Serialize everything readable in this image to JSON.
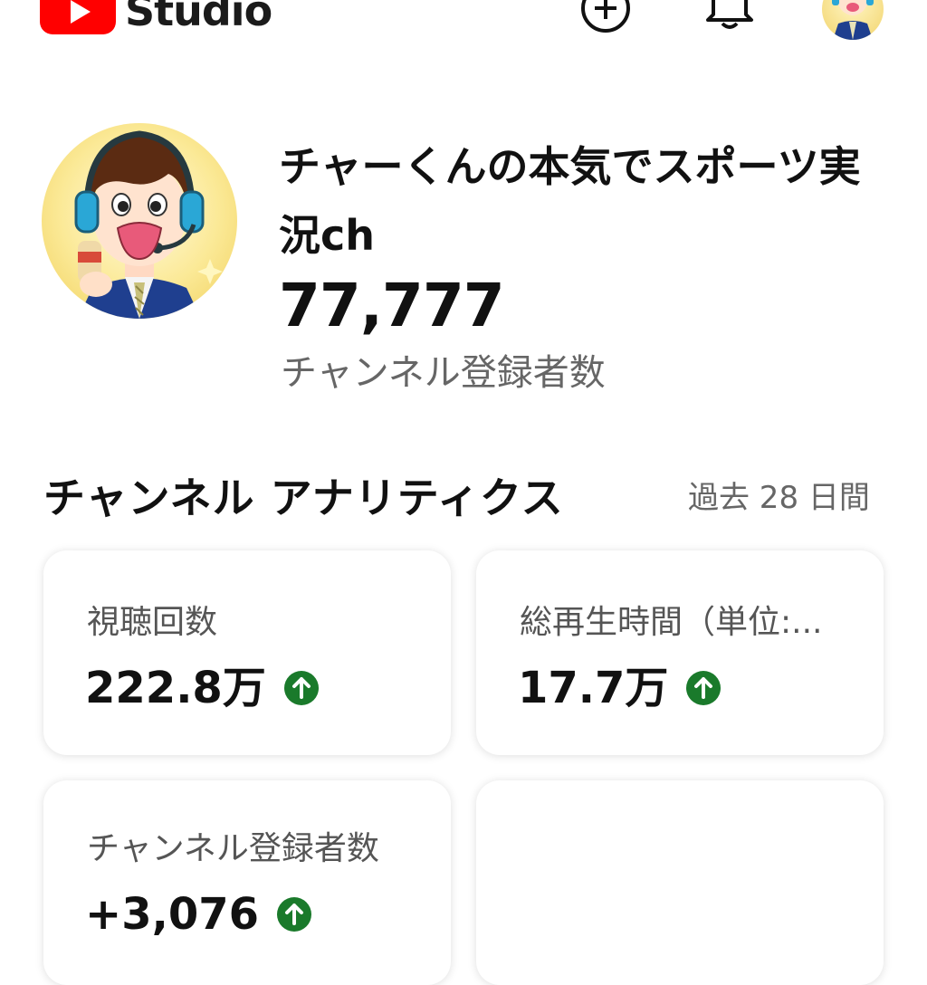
{
  "header": {
    "logo_text": "Studio",
    "icons": [
      "create-icon",
      "bell-icon",
      "account-avatar"
    ]
  },
  "channel": {
    "name": "チャーくんの本気でスポーツ実況ch",
    "subscriber_count": "77,777",
    "subscriber_label": "チャンネル登録者数"
  },
  "analytics": {
    "title": "チャンネル アナリティクス",
    "period": "過去 28 日間",
    "cards": [
      {
        "label": "視聴回数",
        "value": "222.8万",
        "trend": "up"
      },
      {
        "label": "総再生時間（単位:...",
        "value": "17.7万",
        "trend": "up"
      },
      {
        "label": "チャンネル登録者数",
        "value": "+3,076",
        "trend": "up"
      }
    ]
  },
  "colors": {
    "brand_red": "#ff0000",
    "trend_up_green": "#1a7a2b",
    "text_primary": "#111111",
    "text_secondary": "#666666"
  }
}
